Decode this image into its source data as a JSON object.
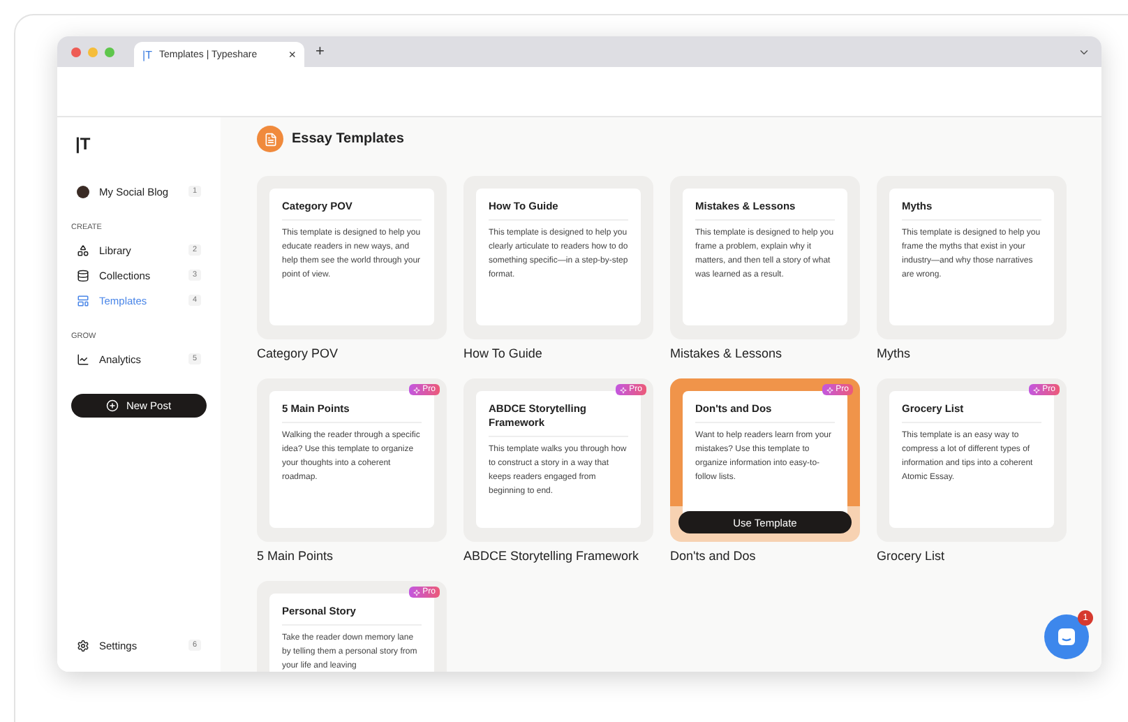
{
  "browser": {
    "tab": {
      "favicon": "|T",
      "title": "Templates | Typeshare",
      "close": "×"
    },
    "new_tab": "+"
  },
  "sidebar": {
    "logo": "|T",
    "blog": {
      "name": "My Social Blog",
      "count": "1"
    },
    "sections": [
      {
        "title": "CREATE",
        "items": [
          {
            "kind": "library",
            "label": "Library",
            "count": "2",
            "selected": false
          },
          {
            "kind": "collections",
            "label": "Collections",
            "count": "3",
            "selected": false
          },
          {
            "kind": "templates",
            "label": "Templates",
            "count": "4",
            "selected": true
          }
        ]
      },
      {
        "title": "GROW",
        "items": [
          {
            "kind": "analytics",
            "label": "Analytics",
            "count": "5",
            "selected": false
          }
        ]
      }
    ],
    "new_post": "New Post",
    "settings": {
      "label": "Settings",
      "count": "6"
    }
  },
  "main": {
    "title": "Essay Templates",
    "templates": [
      {
        "title": "Category POV",
        "description": "This template is designed to help you educate readers in new ways, and help them see the world through your point of view.",
        "name": "Category POV",
        "hovered": false
      },
      {
        "title": "How To Guide",
        "description": "This template is designed to help you clearly articulate to readers how to do something specific—in a step-by-step format.",
        "name": "How To Guide",
        "hovered": false
      },
      {
        "title": "Mistakes & Lessons",
        "description": "This template is designed to help you frame a problem, explain why it matters, and then tell a story of what was learned as a result.",
        "name": "Mistakes & Lessons",
        "hovered": false
      },
      {
        "title": "Myths",
        "description": "This template is designed to help you frame the myths that exist in your industry—and why those narratives are wrong.",
        "name": "Myths",
        "hovered": false
      },
      {
        "title": "5 Main Points",
        "description": "Walking the reader through a specific idea? Use this template to organize your thoughts into a coherent roadmap.",
        "name": "5 Main Points",
        "badge": "Pro",
        "hovered": false
      },
      {
        "title": "ABDCE Storytelling Framework",
        "description": "This template walks you through how to construct a story in a way that keeps readers engaged from beginning to end.",
        "name": "ABDCE Storytelling Framework",
        "badge": "Pro",
        "hovered": false
      },
      {
        "title": "Don'ts and Dos",
        "description": "Want to help readers learn from your mistakes? Use this template to organize information into easy-to-follow lists.",
        "name": "Don'ts and Dos",
        "badge": "Pro",
        "hovered": true,
        "button": "Use Template"
      },
      {
        "title": "Grocery List",
        "description": "This template is an easy way to compress a lot of different types of information and tips into a coherent Atomic Essay.",
        "name": "Grocery List",
        "badge": "Pro",
        "hovered": false
      },
      {
        "title": "Personal Story",
        "description": "Take the reader down memory lane by telling them a personal story from your life and leaving",
        "badge": "Pro",
        "hovered": false
      }
    ]
  },
  "chat": {
    "badge": "1"
  }
}
